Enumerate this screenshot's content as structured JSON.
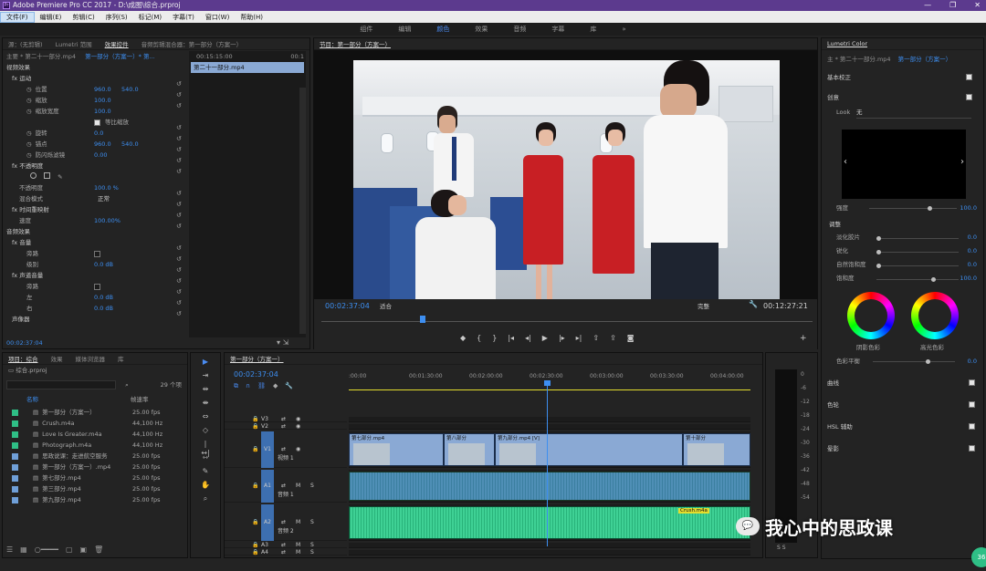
{
  "window": {
    "title": "Adobe Premiere Pro CC 2017 - D:\\成图\\综合.prproj",
    "min": "—",
    "max": "❐",
    "close": "✕"
  },
  "menu": [
    "文件(F)",
    "编辑(E)",
    "剪辑(C)",
    "序列(S)",
    "标记(M)",
    "字幕(T)",
    "窗口(W)",
    "帮助(H)"
  ],
  "workspaces": {
    "items": [
      "组件",
      "编辑",
      "颜色",
      "效果",
      "音频",
      "字幕",
      "库"
    ],
    "active": "颜色",
    "more": "»"
  },
  "effect_controls": {
    "tabs": [
      "源：(无剪辑)",
      "Lumetri 范围",
      "效果控件",
      "音频剪辑混合器：第一部分（方案一）"
    ],
    "active_tab": "效果控件",
    "master": "主要 * 第二十一部分.mp4",
    "sequence": "第一部分（方案一）* 第...",
    "timecode_start": "00:15:15:00",
    "timecode_end": "00:1",
    "clip_name": "第二十一部分.mp4",
    "video_effects": "视频效果",
    "motion": "fx 运动",
    "rows": [
      {
        "label": "位置",
        "v1": "960.0",
        "v2": "540.0"
      },
      {
        "label": "缩放",
        "v1": "100.0",
        "v2": ""
      },
      {
        "label": "缩放宽度",
        "v1": "100.0",
        "v2": ""
      },
      {
        "label": "等比缩放",
        "v1": "",
        "v2": ""
      },
      {
        "label": "旋转",
        "v1": "0.0",
        "v2": ""
      },
      {
        "label": "锚点",
        "v1": "960.0",
        "v2": "540.0"
      },
      {
        "label": "防闪烁滤镜",
        "v1": "0.00",
        "v2": ""
      }
    ],
    "opacity": "fx 不透明度",
    "opacity_val_label": "不透明度",
    "opacity_val": "100.0 %",
    "blend_label": "混合模式",
    "blend_val": "正常",
    "time_remap": "fx 时间重映射",
    "speed_label": "速度",
    "speed_val": "100.00%",
    "audio_effects": "音频效果",
    "volume": "fx 音量",
    "bypass": "旁路",
    "level": "级别",
    "level_val": "0.0 dB",
    "channel_volume": "fx 声道音量",
    "left": "左",
    "left_val": "0.0 dB",
    "right": "右",
    "right_val": "0.0 dB",
    "panner": "声像器",
    "footer_tc": "00:02:37:04"
  },
  "program": {
    "title": "节目：第一部分（方案一）",
    "timecode": "00:02:37:04",
    "fit": "适合",
    "quality": "完整",
    "duration": "00:12:27:21"
  },
  "project": {
    "tabs": [
      "项目：综合",
      "效果",
      "媒体浏览器",
      "库"
    ],
    "active_tab": "项目：综合",
    "file": "综合.prproj",
    "count": "29 个项",
    "headers": {
      "name": "名称",
      "rate": "帧速率"
    },
    "items": [
      {
        "name": "第一部分（方案一）",
        "rate": "25.00 fps",
        "color": "#2fbf86"
      },
      {
        "name": "Crush.m4a",
        "rate": "44,100 Hz",
        "color": "#2fbf86"
      },
      {
        "name": "Love Is Greater.m4a",
        "rate": "44,100 Hz",
        "color": "#2fbf86"
      },
      {
        "name": "Photograph.m4a",
        "rate": "44,100 Hz",
        "color": "#2fbf86"
      },
      {
        "name": "思政说课：走进航空服务",
        "rate": "25.00 fps",
        "color": "#6f9fd8"
      },
      {
        "name": "第一部分（方案一）.mp4",
        "rate": "25.00 fps",
        "color": "#6f9fd8"
      },
      {
        "name": "第七部分.mp4",
        "rate": "25.00 fps",
        "color": "#6f9fd8"
      },
      {
        "name": "第三部分.mp4",
        "rate": "25.00 fps",
        "color": "#6f9fd8"
      },
      {
        "name": "第九部分.mp4",
        "rate": "25.00 fps",
        "color": "#6f9fd8"
      }
    ]
  },
  "timeline": {
    "title": "第一部分（方案一）",
    "timecode": "00:02:37:04",
    "ruler": [
      ":00:00",
      "00:01:30:00",
      "00:02:00:00",
      "00:02:30:00",
      "00:03:00:00",
      "00:03:30:00",
      "00:04:00:00"
    ],
    "tracks": [
      {
        "id": "V3",
        "name": ""
      },
      {
        "id": "V2",
        "name": ""
      },
      {
        "id": "V1",
        "name": "视频 1"
      },
      {
        "id": "A1",
        "name": "音频 1"
      },
      {
        "id": "A2",
        "name": "音频 2"
      },
      {
        "id": "A3",
        "name": ""
      },
      {
        "id": "A4",
        "name": ""
      }
    ],
    "clips": [
      "第七部分.mp4",
      "第八部分",
      "第九部分.mp4 [V]",
      "第十部分"
    ],
    "audio_clip": "Crush.m4a",
    "meter_labels": [
      "0",
      "-6",
      "-12",
      "-18",
      "-24",
      "-30",
      "-36",
      "-42",
      "-48",
      "-54"
    ]
  },
  "lumetri": {
    "title": "Lumetri Color",
    "master": "主 * 第二十一部分.mp4",
    "sequence": "第一部分（方案一）",
    "basic": "基本校正",
    "creative": "创意",
    "look_label": "Look",
    "look_val": "无",
    "intensity_label": "强度",
    "intensity_val": "100.0",
    "adjust": "调整",
    "adjust_rows": [
      {
        "label": "淡化胶片",
        "val": "0.0"
      },
      {
        "label": "锐化",
        "val": "0.0"
      },
      {
        "label": "自然饱和度",
        "val": "0.0"
      },
      {
        "label": "饱和度",
        "val": "100.0"
      }
    ],
    "shadow": "阴影色彩",
    "highlight": "高光色彩",
    "tint_balance": "色彩平衡",
    "tint_val": "0.0",
    "sections": [
      "曲线",
      "色轮",
      "HSL 辅助",
      "晕影"
    ]
  },
  "watermark": {
    "text": "我心中的思政课",
    "badge": "36"
  }
}
